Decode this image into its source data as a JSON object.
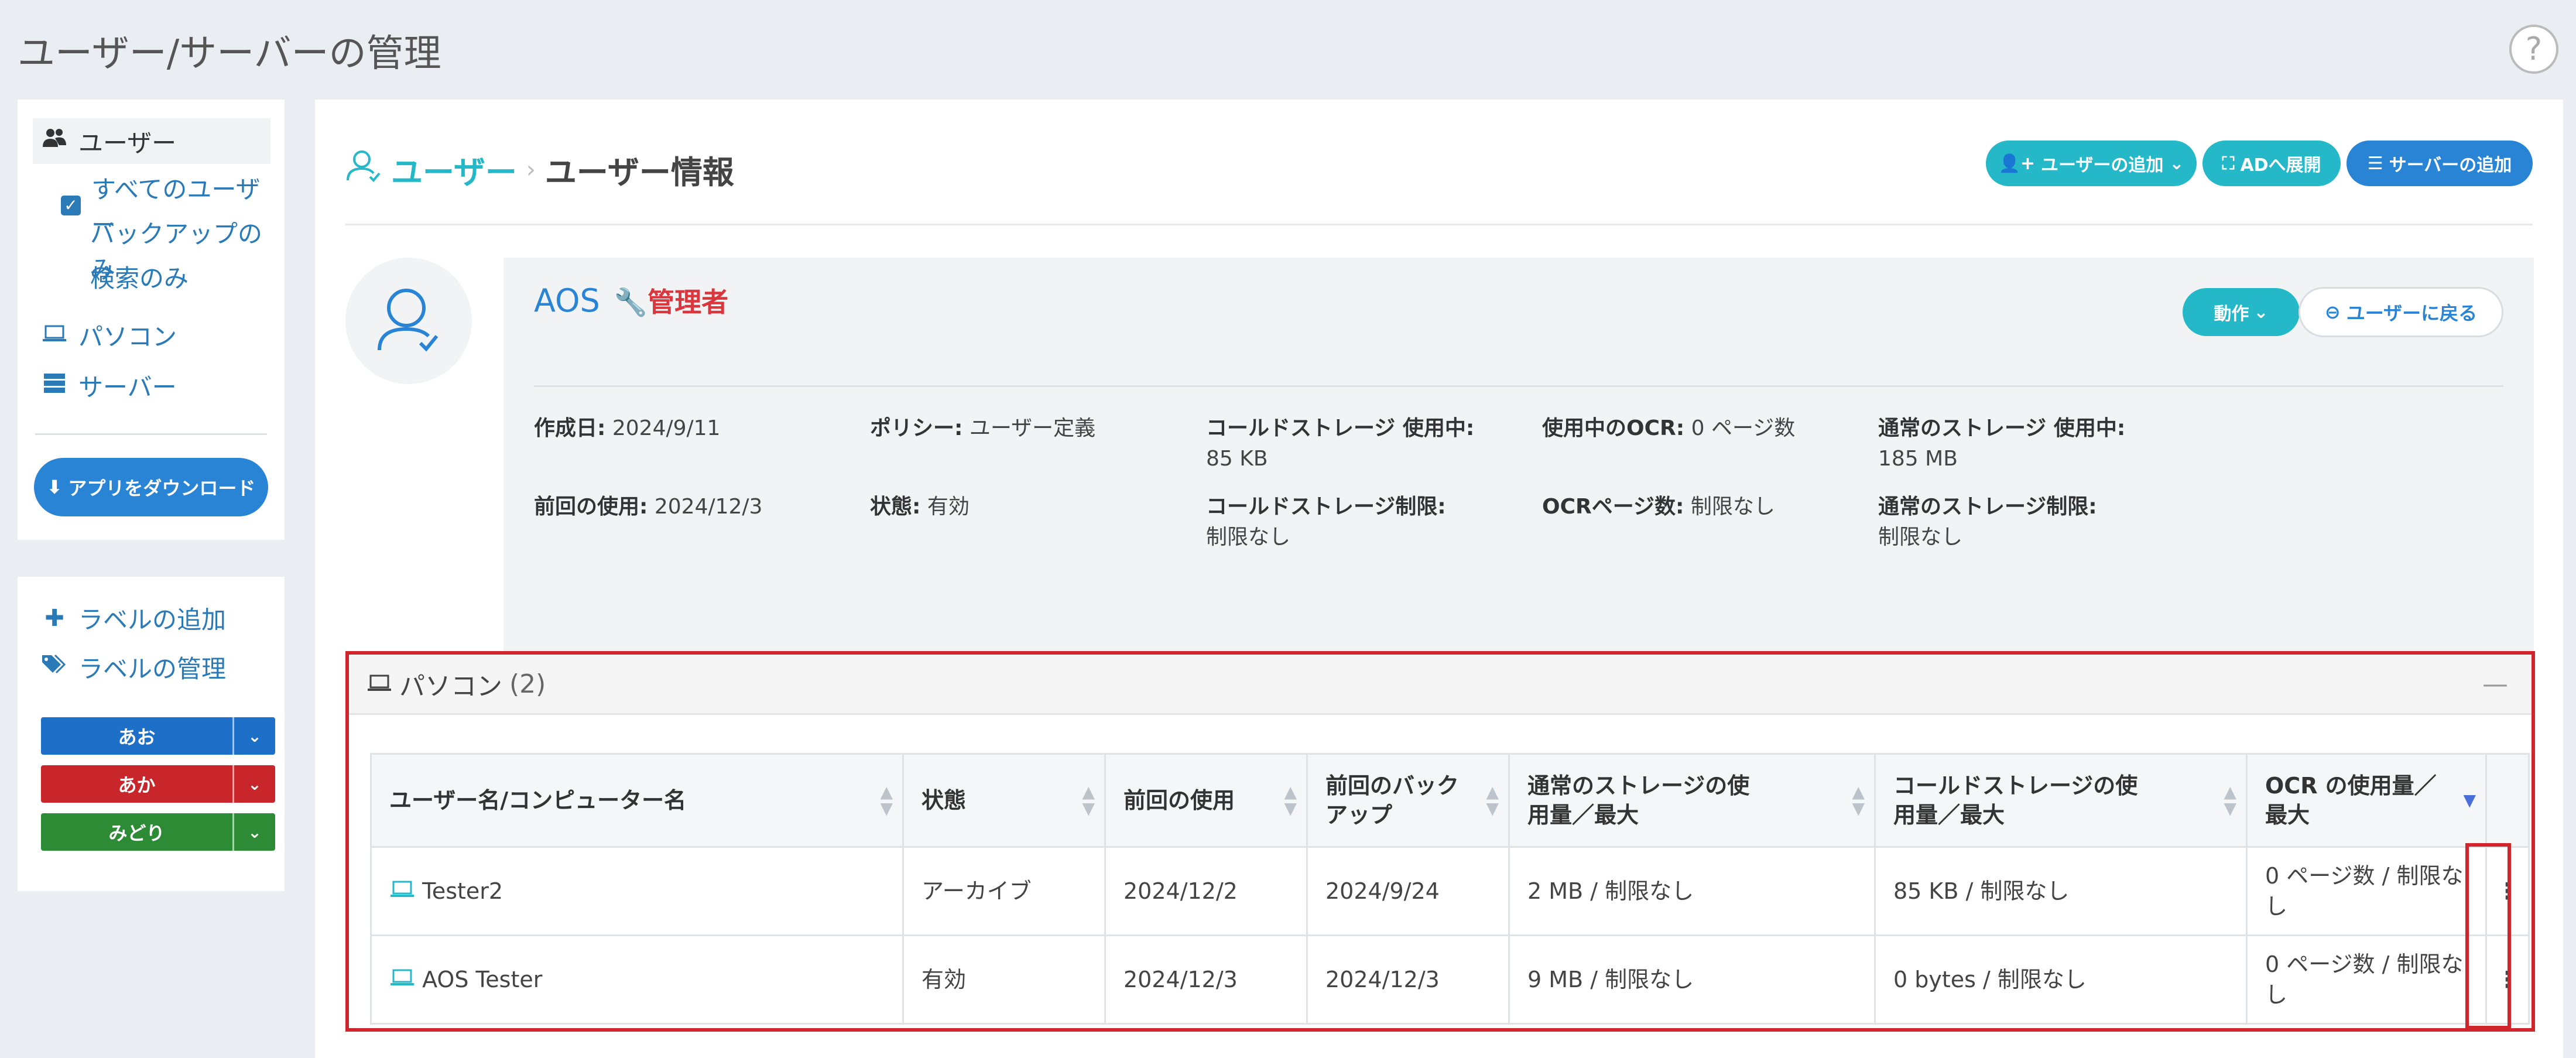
{
  "page": {
    "title": "ユーザー/サーバーの管理",
    "help_icon": "?"
  },
  "nav": {
    "users": "ユーザー",
    "all_users": "すべてのユーザー",
    "backup_only": "バックアップのみ",
    "search_only": "検索のみ",
    "pc": "パソコン",
    "server": "サーバー",
    "download": "アプリをダウンロード"
  },
  "labels": {
    "add": "ラベルの追加",
    "manage": "ラベルの管理",
    "items": [
      {
        "name": "あお",
        "color": "#1e6fc8"
      },
      {
        "name": "あか",
        "color": "#c9262c"
      },
      {
        "name": "みどり",
        "color": "#2e8b35"
      }
    ]
  },
  "breadcrumb": {
    "root": "ユーザー",
    "separator": "›",
    "current": "ユーザー情報"
  },
  "actions": {
    "add_user": "ユーザーの追加",
    "deploy_ad": "ADへ展開",
    "add_server": "サーバーの追加"
  },
  "user": {
    "name": "AOS",
    "role": "管理者",
    "action_btn": "動作",
    "back_btn": "ユーザーに戻る"
  },
  "fields": {
    "created_label": "作成日:",
    "created_value": "2024/9/11",
    "last_used_label": "前回の使用:",
    "last_used_value": "2024/12/3",
    "policy_label": "ポリシー:",
    "policy_value": "ユーザー定義",
    "status_label": "状態:",
    "status_value": "有効",
    "cold_used_label": "コールドストレージ 使用中:",
    "cold_used_value": "85 KB",
    "cold_limit_label": "コールドストレージ制限:",
    "cold_limit_value": "制限なし",
    "ocr_used_label": "使用中のOCR:",
    "ocr_used_value": "0 ページ数",
    "ocr_pages_label": "OCRページ数:",
    "ocr_pages_value": "制限なし",
    "std_used_label": "通常のストレージ 使用中:",
    "std_used_value": "185 MB",
    "std_limit_label": "通常のストレージ制限:",
    "std_limit_value": "制限なし"
  },
  "computers": {
    "title": "パソコン",
    "count": "(2)",
    "collapse": "—",
    "columns": [
      "ユーザー名/コンピューター名",
      "状態",
      "前回の使用",
      "前回のバックアップ",
      "通常のストレージの使用量／最大",
      "コールドストレージの使用量／最大",
      "OCR の使用量／最大"
    ],
    "rows": [
      {
        "name": "Tester2",
        "status": "アーカイブ",
        "last_used": "2024/12/2",
        "last_backup": "2024/9/24",
        "standard": "2 MB / 制限なし",
        "cold": "85 KB / 制限なし",
        "ocr": "0 ページ数 / 制限なし"
      },
      {
        "name": "AOS Tester",
        "status": "有効",
        "last_used": "2024/12/3",
        "last_backup": "2024/12/3",
        "standard": "9 MB / 制限なし",
        "cold": "0 bytes / 制限なし",
        "ocr": "0 ページ数 / 制限なし"
      }
    ]
  },
  "colors": {
    "accent": "#25b8c8",
    "primary": "#2a84d6",
    "danger": "#d0252a"
  }
}
